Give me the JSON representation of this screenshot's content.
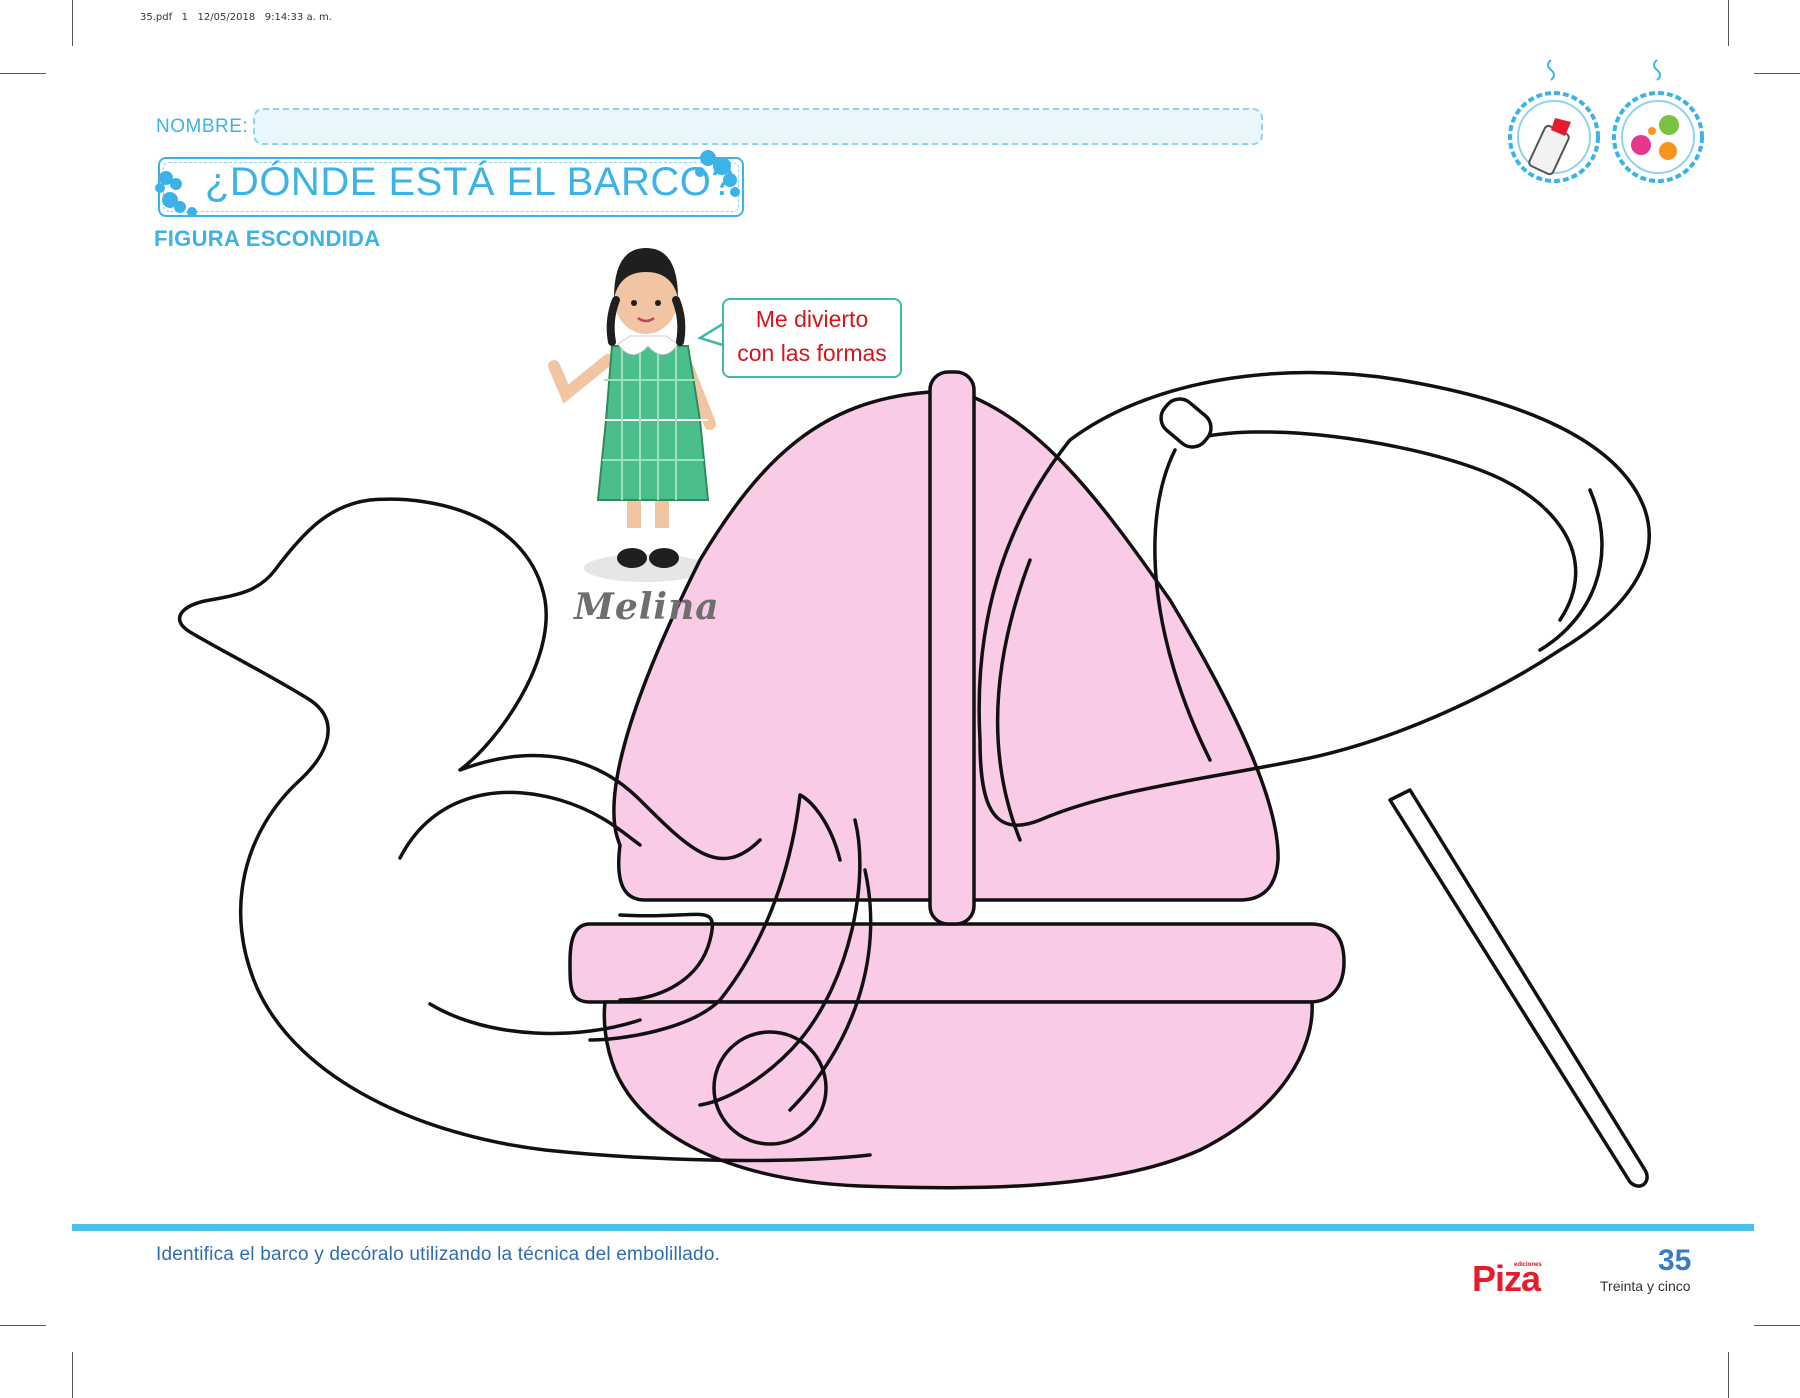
{
  "file_stamp": "35.pdf   1   12/05/2018   9:14:33 a. m.",
  "header": {
    "name_label": "NOMBRE:",
    "name_value": "",
    "title": "¿DÓNDE ESTÁ EL BARCO?",
    "subtitle": "FIGURA ESCONDIDA"
  },
  "materials": [
    "glue-bottle-icon",
    "tissue-paper-balls-icon"
  ],
  "character": {
    "name": "Melina",
    "speech": "Me divierto con las formas"
  },
  "figure": {
    "shapes": [
      "duck",
      "sailboat",
      "umbrella"
    ],
    "highlighted": "sailboat",
    "highlight_color": "#f9cbe7"
  },
  "footer": {
    "instruction": "Identifica el barco y decóralo utilizando la técnica del embolillado.",
    "brand_small": "ediciones",
    "brand": "Piza",
    "page_number": "35",
    "page_number_words": "Treinta y cinco"
  },
  "colors": {
    "accent": "#3bb3e6",
    "speech_text": "#d7141c",
    "instruction_text": "#2e6db4",
    "rule": "#4cc1ee"
  }
}
